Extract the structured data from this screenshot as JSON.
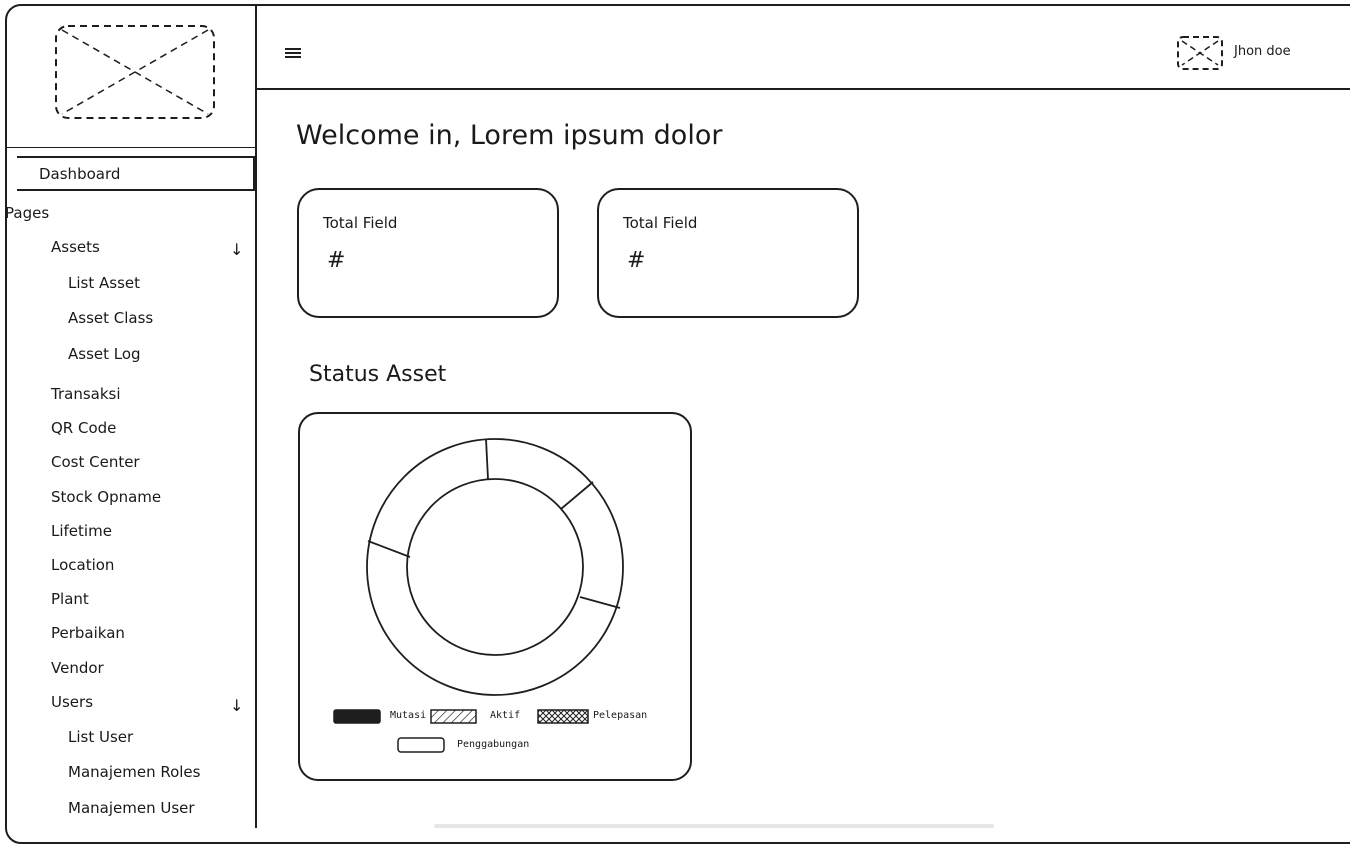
{
  "header": {
    "user_name": "Jhon doe"
  },
  "sidebar": {
    "dashboard": "Dashboard",
    "section": "Pages",
    "items": [
      {
        "label": "Assets",
        "expandable": true
      },
      {
        "label": "List Asset"
      },
      {
        "label": "Asset Class"
      },
      {
        "label": "Asset Log"
      },
      {
        "label": "Transaksi"
      },
      {
        "label": "QR Code"
      },
      {
        "label": "Cost Center"
      },
      {
        "label": "Stock Opname"
      },
      {
        "label": "Lifetime"
      },
      {
        "label": "Location"
      },
      {
        "label": "Plant"
      },
      {
        "label": "Perbaikan"
      },
      {
        "label": "Vendor"
      },
      {
        "label": "Users",
        "expandable": true
      },
      {
        "label": "List User"
      },
      {
        "label": "Manajemen Roles"
      },
      {
        "label": "Manajemen User"
      }
    ]
  },
  "main": {
    "welcome": "Welcome in, Lorem ipsum dolor",
    "cards": [
      {
        "label": "Total Field",
        "value": "#"
      },
      {
        "label": "Total Field",
        "value": "#"
      }
    ],
    "status_title": "Status Asset"
  },
  "legend": {
    "items": [
      "Mutasi",
      "Aktif",
      "Pelepasan",
      "Penggabungan"
    ]
  },
  "colors": {
    "stroke": "#1e1e1e",
    "background": "#ffffff"
  }
}
